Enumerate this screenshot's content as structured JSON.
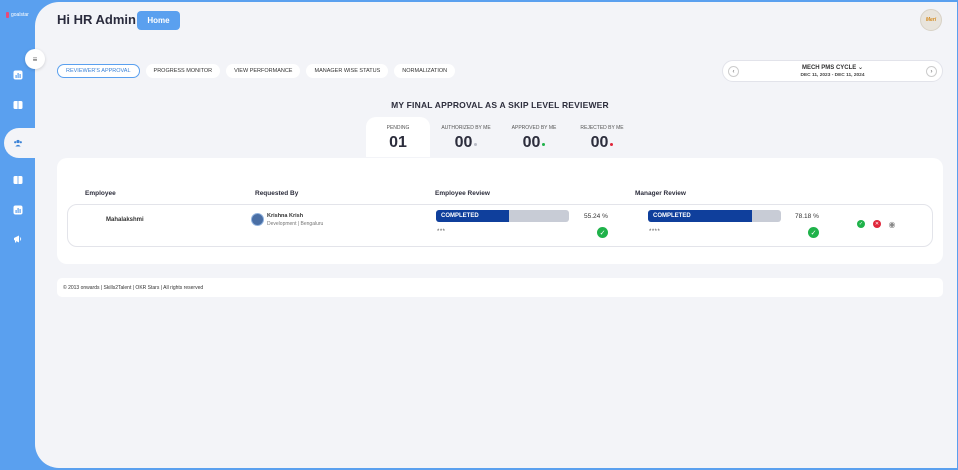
{
  "app": {
    "logo_text": "goalstar"
  },
  "header": {
    "greeting": "Hi HR Admin",
    "home_label": "Home",
    "avatar_text": "Meri"
  },
  "tabs": [
    {
      "label": "REVIEWER'S APPROVAL",
      "selected": true
    },
    {
      "label": "PROGRESS MONITOR",
      "selected": false
    },
    {
      "label": "VIEW PERFORMANCE",
      "selected": false
    },
    {
      "label": "MANAGER WISE STATUS",
      "selected": false
    },
    {
      "label": "NORMALIZATION",
      "selected": false
    }
  ],
  "cycle": {
    "title": "MECH PMS CYCLE",
    "dates": "DEC 11, 2023 - DEC 11, 2024",
    "prev": "‹",
    "next": "›",
    "chevron": "⌄"
  },
  "section": {
    "title": "MY FINAL APPROVAL AS A SKIP LEVEL REVIEWER"
  },
  "stats": [
    {
      "label": "PENDING",
      "value": "01",
      "dot_color": ""
    },
    {
      "label": "AUTHORIZED BY ME",
      "value": "00",
      "dot_color": "#b9bcc6"
    },
    {
      "label": "APPROVED BY ME",
      "value": "00",
      "dot_color": "#1fb24a"
    },
    {
      "label": "REJECTED BY ME",
      "value": "00",
      "dot_color": "#e0263a"
    }
  ],
  "table": {
    "headers": {
      "employee": "Employee",
      "requested_by": "Requested By",
      "employee_review": "Employee Review",
      "manager_review": "Manager Review"
    },
    "rows": [
      {
        "employee": "Mahalakshmi",
        "requester_name": "Krishna Krish",
        "requester_sub": "Development | Bengaluru",
        "employee_review": {
          "status": "COMPLETED",
          "percent": "55.24 %",
          "progress": 0.55,
          "stars": "***"
        },
        "manager_review": {
          "status": "COMPLETED",
          "percent": "78.18 %",
          "progress": 0.78,
          "stars": "****"
        }
      }
    ]
  },
  "footer": {
    "text": "© 2013 onwards | Skills2Talent | OKR Stars | All rights reserved"
  },
  "colors": {
    "accent": "#5aa0ef",
    "progress_fill": "#0f3f9c",
    "success": "#1fb24a",
    "danger": "#e0263a"
  }
}
